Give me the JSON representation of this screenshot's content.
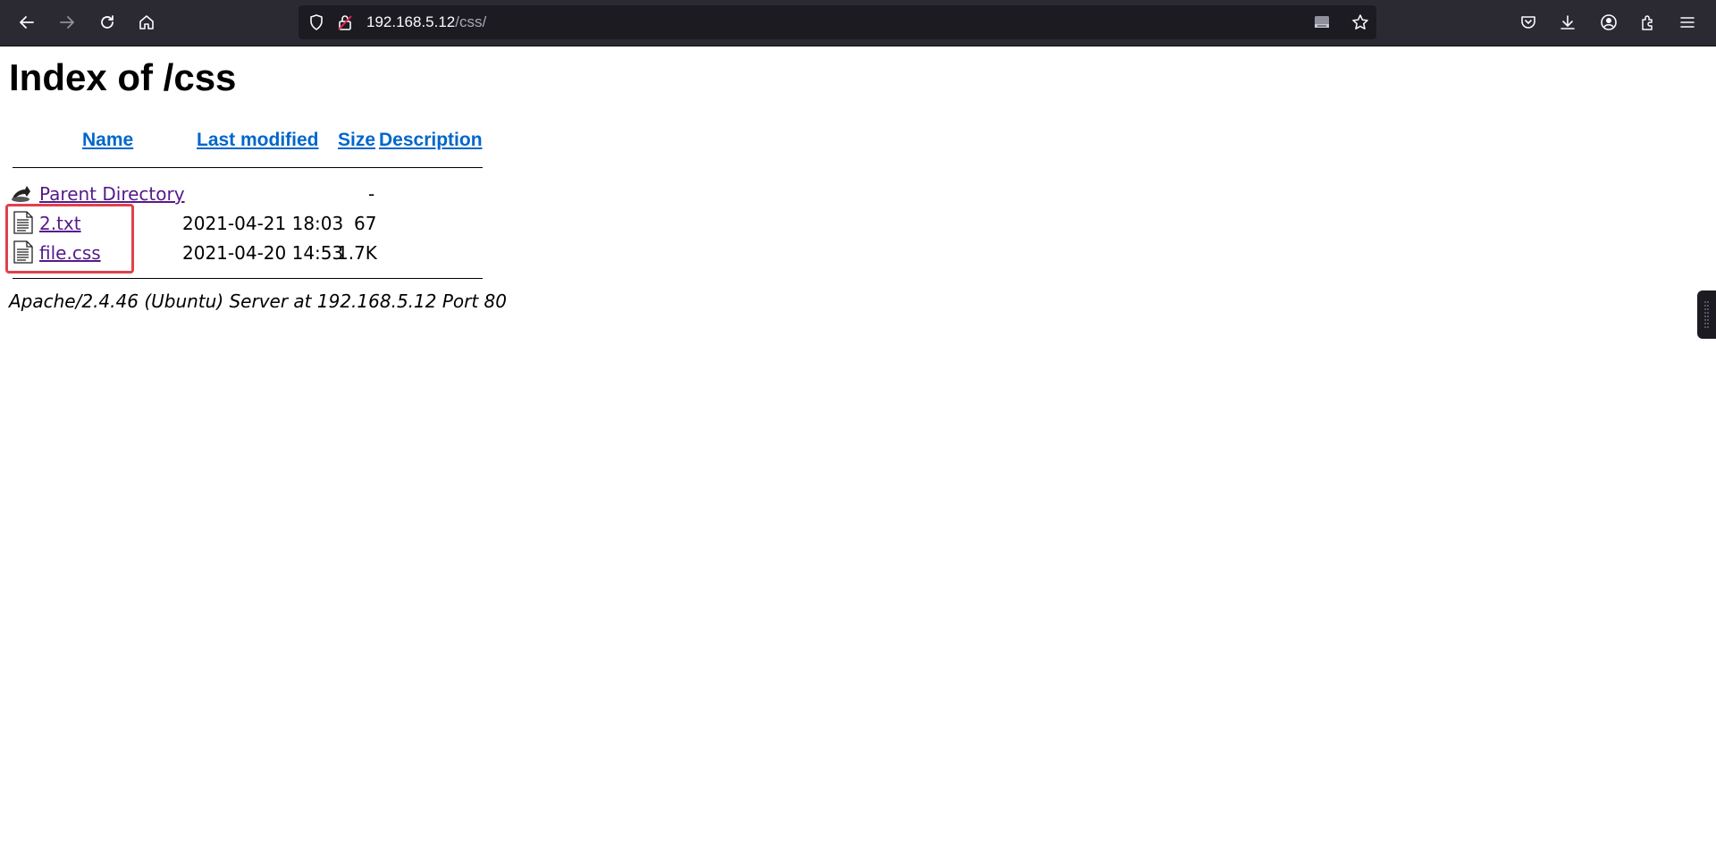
{
  "browser": {
    "url_host": "192.168.5.12",
    "url_path": "/css/"
  },
  "page": {
    "title": "Index of /css",
    "columns": {
      "name": "Name",
      "last_modified": "Last modified",
      "size": "Size",
      "description": "Description"
    },
    "parent": {
      "name": "Parent Directory",
      "size": "-"
    },
    "files": [
      {
        "name": "2.txt",
        "last_modified": "2021-04-21 18:03",
        "size": "67"
      },
      {
        "name": "file.css",
        "last_modified": "2021-04-20 14:53",
        "size": "1.7K"
      }
    ],
    "footer": "Apache/2.4.46 (Ubuntu) Server at 192.168.5.12 Port 80"
  },
  "colors": {
    "toolbar_bg": "#2b2a33",
    "urlbar_bg": "#1c1b22",
    "link_header": "#0066cc",
    "link_visited": "#551a8b",
    "highlight_border": "#e0414b"
  },
  "icons": [
    "back-icon",
    "forward-icon",
    "reload-icon",
    "home-icon",
    "shield-icon",
    "insecure-lock-icon",
    "reader-view-icon",
    "bookmark-star-icon",
    "pocket-icon",
    "downloads-icon",
    "account-icon",
    "extensions-icon",
    "menu-icon",
    "parent-directory-icon",
    "text-file-icon"
  ]
}
